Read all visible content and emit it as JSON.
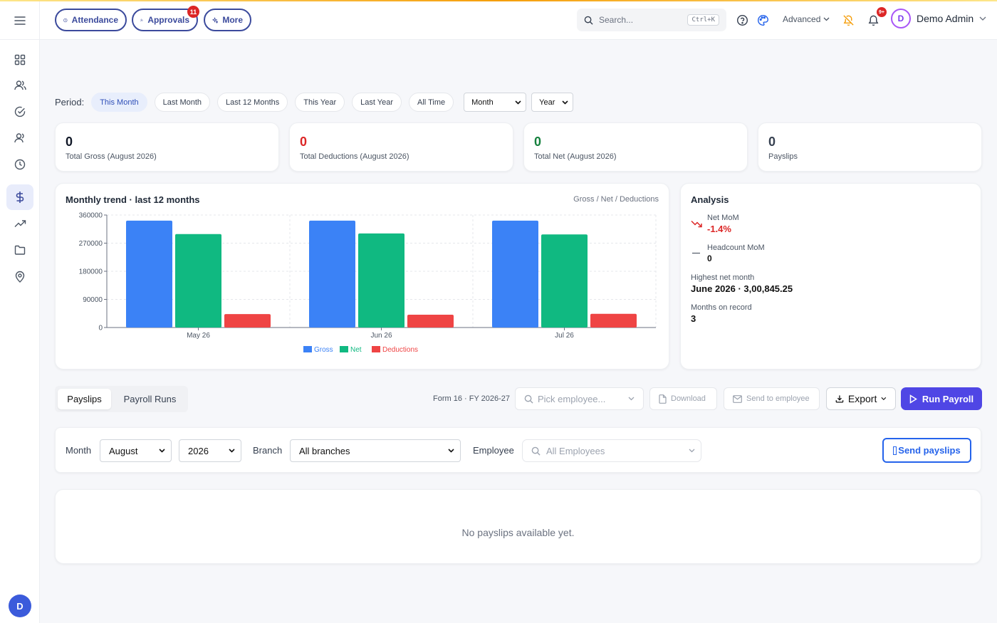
{
  "topbar": {
    "attendance_label": "Attendance",
    "approvals_label": "Approvals",
    "approvals_badge": "11",
    "more_label": "More",
    "search_placeholder": "Search...",
    "search_shortcut": "Ctrl+K",
    "advanced_label": "Advanced",
    "notifications_badge": "9+",
    "user_initial": "D",
    "user_name": "Demo Admin"
  },
  "sidebar": {
    "items": [
      "menu-icon",
      "dashboard-icon",
      "users-icon",
      "check-circle-icon",
      "team-icon",
      "clock-icon",
      "dollar-icon",
      "trending-up-icon",
      "folder-icon",
      "map-pin-icon"
    ],
    "active": "dollar-icon",
    "avatar_initial": "D"
  },
  "period": {
    "label": "Period:",
    "chips": [
      "This Month",
      "Last Month",
      "Last 12 Months",
      "This Year",
      "Last Year",
      "All Time"
    ],
    "active": "This Month",
    "month_select": "Month",
    "year_select": "Year"
  },
  "stats": [
    {
      "value": "0",
      "label": "Total Gross (August 2026)",
      "color": "#111827"
    },
    {
      "value": "0",
      "label": "Total Deductions (August 2026)",
      "color": "#dc2626"
    },
    {
      "value": "0",
      "label": "Total Net (August 2026)",
      "color": "#15803d"
    },
    {
      "value": "0",
      "label": "Payslips",
      "color": "#374151"
    }
  ],
  "chart_panel": {
    "title": "Monthly trend · last 12 months",
    "subtitle": "Gross / Net / Deductions"
  },
  "chart_data": {
    "type": "bar",
    "categories": [
      "May 26",
      "Jun 26",
      "Jul 26"
    ],
    "series": [
      {
        "name": "Gross",
        "color": "#3b82f6",
        "values": [
          342000,
          342000,
          342000
        ]
      },
      {
        "name": "Net",
        "color": "#10b981",
        "values": [
          299000,
          301000,
          298000
        ]
      },
      {
        "name": "Deductions",
        "color": "#ef4444",
        "values": [
          43000,
          41000,
          44000
        ]
      }
    ],
    "yticks": [
      "0",
      "90000",
      "180000",
      "270000",
      "360000"
    ],
    "ylim": [
      0,
      360000
    ],
    "grid": true,
    "legend": "bottom"
  },
  "analysis": {
    "title": "Analysis",
    "net_mom_label": "Net MoM",
    "net_mom_value": "-1.4%",
    "headcount_label": "Headcount MoM",
    "headcount_value": "0",
    "highest_label": "Highest net month",
    "highest_value": "June 2026 · 3,00,845.25",
    "months_label": "Months on record",
    "months_value": "3"
  },
  "tabs": [
    "Payslips",
    "Payroll Runs"
  ],
  "toolbar": {
    "form16_label": "Form 16 · FY 2026-27",
    "pick_employee_placeholder": "Pick employee...",
    "download_label": "Download",
    "send_to_employee_label": "Send to employee",
    "export_label": "Export",
    "run_payroll_label": "Run Payroll"
  },
  "filters": {
    "month_label": "Month",
    "month_value": "August",
    "year_value": "2026",
    "branch_label": "Branch",
    "branch_value": "All branches",
    "employee_label": "Employee",
    "employee_placeholder": "All Employees",
    "send_payslips_label": "Send payslips"
  },
  "empty_state": "No payslips available yet."
}
